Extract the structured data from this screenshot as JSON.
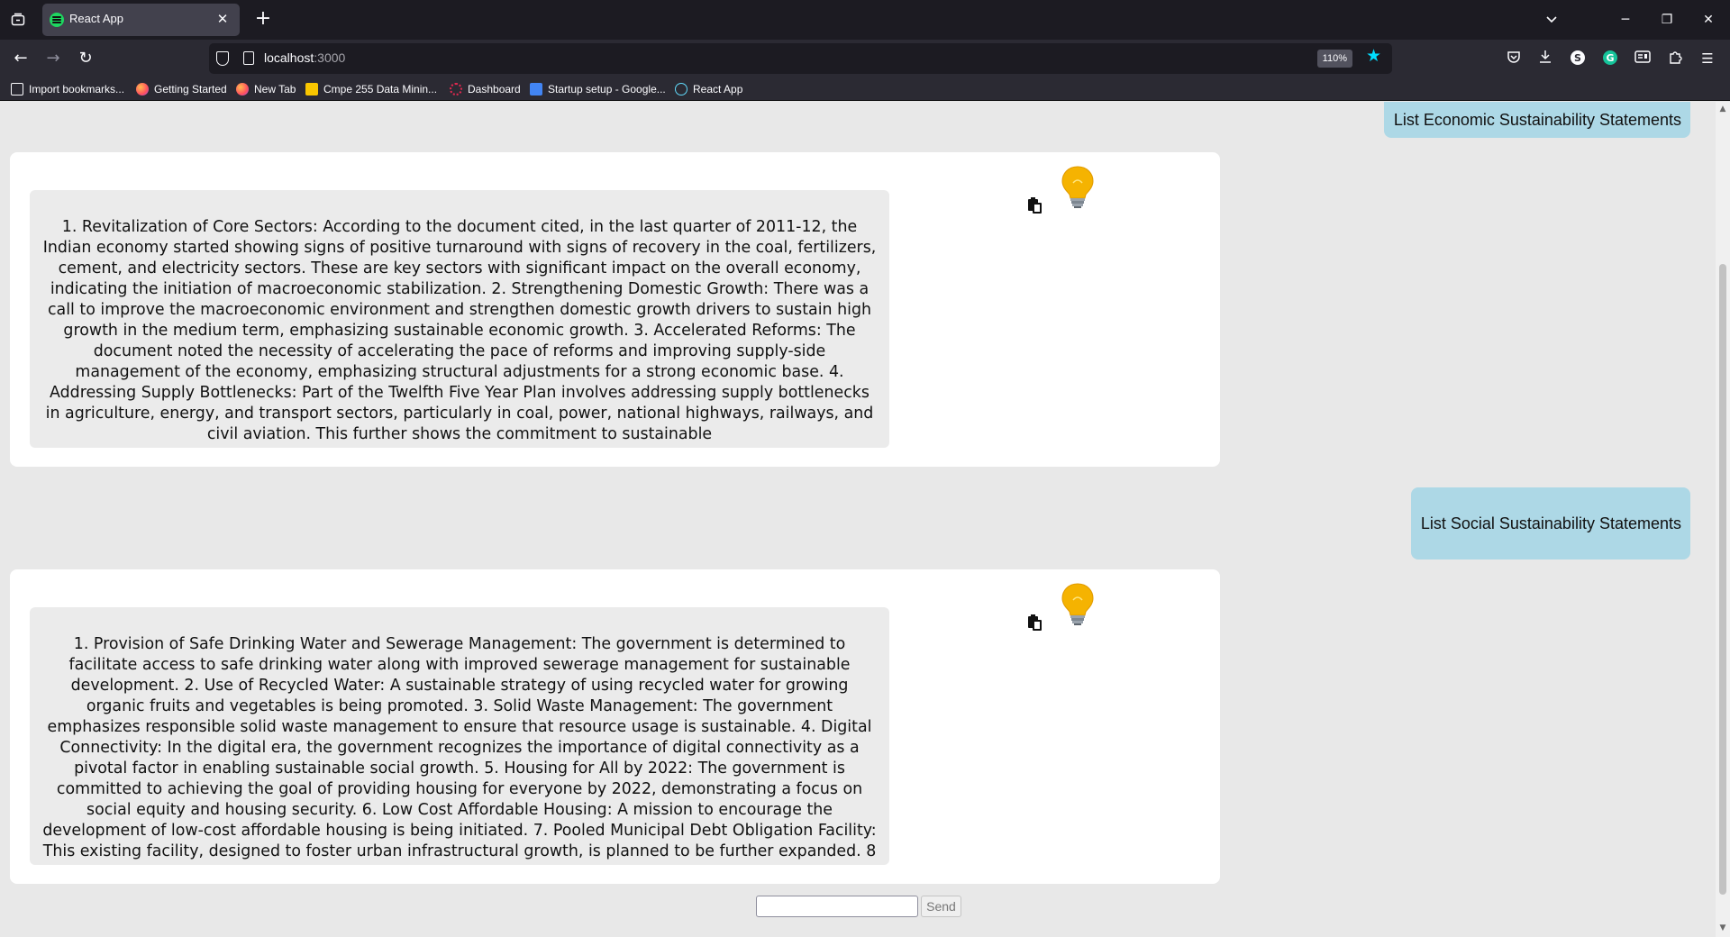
{
  "browser": {
    "tab_title": "React App",
    "url_host": "localhost",
    "url_port": ":3000",
    "zoom": "110%",
    "bookmarks": [
      {
        "label": "Import bookmarks...",
        "icon": "import-icon"
      },
      {
        "label": "Getting Started",
        "icon": "firefox-icon"
      },
      {
        "label": "New Tab",
        "icon": "firefox-icon"
      },
      {
        "label": "Cmpe 255 Data Minin...",
        "icon": "folder-icon"
      },
      {
        "label": "Dashboard",
        "icon": "dashboard-icon"
      },
      {
        "label": "Startup setup - Google...",
        "icon": "docs-icon"
      },
      {
        "label": "React App",
        "icon": "react-icon"
      }
    ],
    "colors": {
      "tabbar": "#1c1b22",
      "navbar": "#2b2a33",
      "accent": "#00ddff"
    }
  },
  "chat": {
    "messages": [
      {
        "role": "user",
        "text": "List Economic Sustainability Statements"
      },
      {
        "role": "bot",
        "text": "1. Revitalization of Core Sectors: According to the document cited, in the last quarter of 2011-12, the Indian economy started showing signs of positive turnaround with signs of recovery in the coal, fertilizers, cement, and electricity sectors. These are key sectors with significant impact on the overall economy, indicating the initiation of macroeconomic stabilization. 2. Strengthening Domestic Growth: There was a call to improve the macroeconomic environment and strengthen domestic growth drivers to sustain high growth in the medium term, emphasizing sustainable economic growth. 3. Accelerated Reforms: The document noted the necessity of accelerating the pace of reforms and improving supply-side management of the economy, emphasizing structural adjustments for a strong economic base. 4. Addressing Supply Bottlenecks: Part of the Twelfth Five Year Plan involves addressing supply bottlenecks in agriculture, energy, and transport sectors, particularly in coal, power, national highways, railways, and civil aviation. This further shows the commitment to sustainable"
      },
      {
        "role": "user",
        "text": "List Social Sustainability Statements"
      },
      {
        "role": "bot",
        "text": "1. Provision of Safe Drinking Water and Sewerage Management: The government is determined to facilitate access to safe drinking water along with improved sewerage management for sustainable development. 2. Use of Recycled Water: A sustainable strategy of using recycled water for growing organic fruits and vegetables is being promoted. 3. Solid Waste Management: The government emphasizes responsible solid waste management to ensure that resource usage is sustainable. 4. Digital Connectivity: In the digital era, the government recognizes the importance of digital connectivity as a pivotal factor in enabling sustainable social growth. 5. Housing for All by 2022: The government is committed to achieving the goal of providing housing for everyone by 2022, demonstrating a focus on social equity and housing security. 6. Low Cost Affordable Housing: A mission to encourage the development of low-cost affordable housing is being initiated. 7. Pooled Municipal Debt Obligation Facility: This existing facility, designed to foster urban infrastructural growth, is planned to be further expanded. 8"
      }
    ],
    "input_value": "",
    "send_label": "Send",
    "colors": {
      "user_bubble": "#add8e6",
      "bot_text_bg": "#ebebeb",
      "page_bg": "#e8e8e8"
    }
  }
}
